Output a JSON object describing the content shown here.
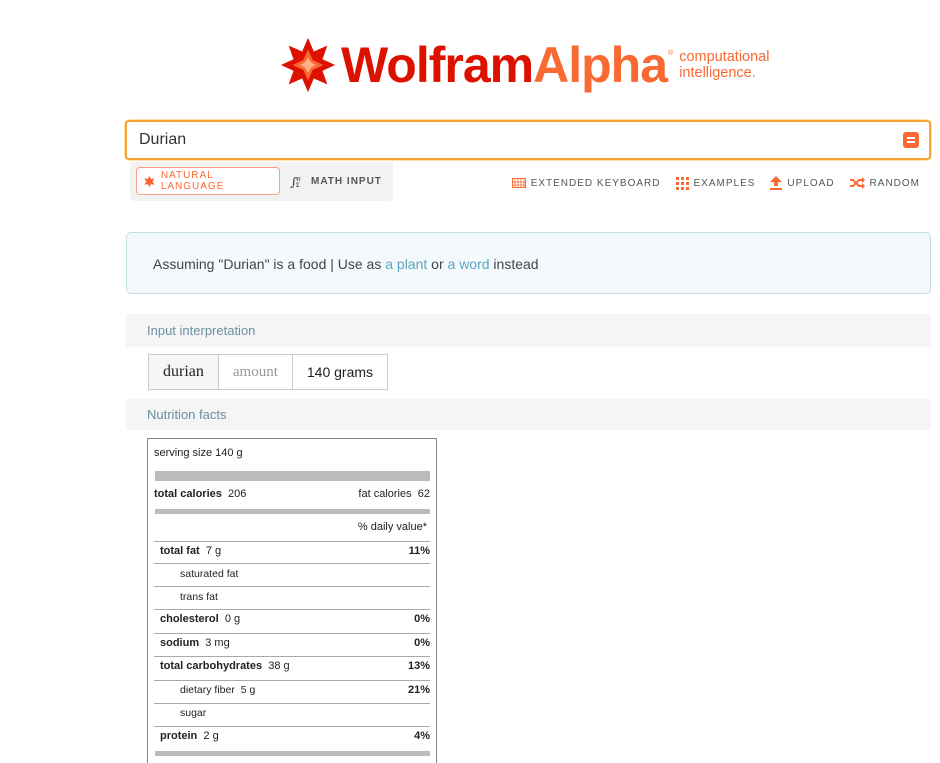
{
  "logo": {
    "wolfram": "Wolfram",
    "alpha": "Alpha",
    "reg": "®",
    "tag1": "computational",
    "tag2": "intelligence."
  },
  "search": {
    "value": "Durian"
  },
  "modes": {
    "natural": "NATURAL LANGUAGE",
    "math": "MATH INPUT"
  },
  "toolbar": {
    "keyboard": "EXTENDED KEYBOARD",
    "examples": "EXAMPLES",
    "upload": "UPLOAD",
    "random": "RANDOM"
  },
  "assumption": {
    "prefix": "Assuming \"Durian\" is a food | Use as ",
    "link1": "a plant",
    "mid": " or ",
    "link2": "a word",
    "suffix": " instead"
  },
  "input_interpretation": {
    "title": "Input interpretation",
    "item": "durian",
    "property": "amount",
    "value": "140 grams"
  },
  "nutrition": {
    "title": "Nutrition facts",
    "serving": "serving size 140 g",
    "total_calories_label": "total calories",
    "total_calories": "206",
    "fat_calories_label": "fat calories",
    "fat_calories": "62",
    "dv_header": "% daily value*",
    "rows": [
      {
        "label": "total fat",
        "amount": "7 g",
        "dv": "11%"
      },
      {
        "label": "saturated fat",
        "amount": "",
        "dv": ""
      },
      {
        "label": "trans fat",
        "amount": "",
        "dv": ""
      },
      {
        "label": "cholesterol",
        "amount": "0 g",
        "dv": "0%"
      },
      {
        "label": "sodium",
        "amount": "3 mg",
        "dv": "0%"
      },
      {
        "label": "total carbohydrates",
        "amount": "38 g",
        "dv": "13%"
      },
      {
        "label": "dietary fiber",
        "amount": "5 g",
        "dv": "21%"
      },
      {
        "label": "sugar",
        "amount": "",
        "dv": ""
      },
      {
        "label": "protein",
        "amount": "2 g",
        "dv": "4%"
      }
    ]
  }
}
